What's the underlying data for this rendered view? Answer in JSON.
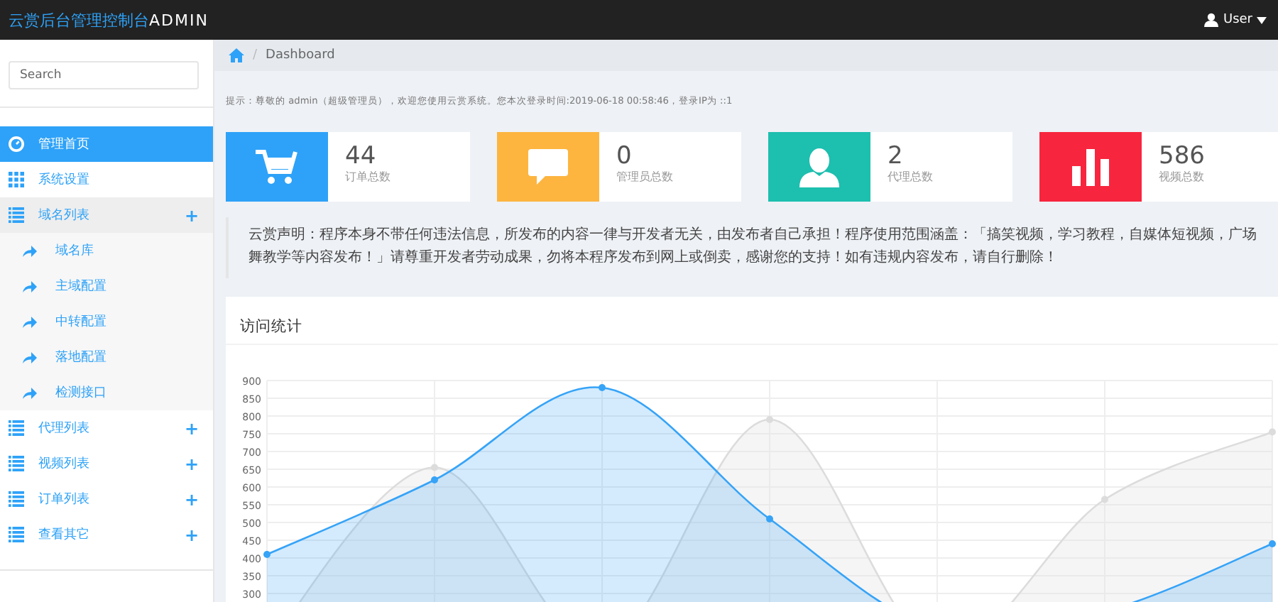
{
  "topbar": {
    "title": "云赏后台管理控制台",
    "title_suffix": "ADMIN",
    "user": "User"
  },
  "sidebar": {
    "search": {
      "placeholder": "Search"
    },
    "items": [
      {
        "label": "管理首页",
        "kind": "link",
        "selected": true
      },
      {
        "label": "系统设置",
        "kind": "link",
        "selected": false
      },
      {
        "label": "域名列表",
        "kind": "group",
        "selected": false,
        "expanded": true,
        "toggle": "+",
        "children": [
          {
            "label": "域名库",
            "selected": false
          },
          {
            "label": "主域配置",
            "selected": false
          },
          {
            "label": "中转配置",
            "selected": false
          },
          {
            "label": "落地配置",
            "selected": false
          },
          {
            "label": "检测接口",
            "selected": false
          }
        ]
      },
      {
        "label": "代理列表",
        "kind": "group",
        "selected": false,
        "expanded": false,
        "toggle": "+"
      },
      {
        "label": "视频列表",
        "kind": "group",
        "selected": false,
        "expanded": false,
        "toggle": "+"
      },
      {
        "label": "订单列表",
        "kind": "group",
        "selected": false,
        "expanded": false,
        "toggle": "+"
      },
      {
        "label": "查看其它",
        "kind": "group",
        "selected": false,
        "expanded": false,
        "toggle": "+"
      }
    ]
  },
  "breadcrumb": {
    "separator": "/",
    "current": "Dashboard"
  },
  "notice": "提示：尊敬的 admin（超级管理员），欢迎您使用云赏系统。您本次登录时间:2019-06-18 00:58:46，登录IP为 ::1",
  "stats": [
    {
      "value": "44",
      "label": "订单总数",
      "color": "#2ea2f8"
    },
    {
      "value": "0",
      "label": "管理员总数",
      "color": "#fdb540"
    },
    {
      "value": "2",
      "label": "代理总数",
      "color": "#1dbfaf"
    },
    {
      "value": "586",
      "label": "视频总数",
      "color": "#f8253e"
    }
  ],
  "announcement": "云赏声明：程序本身不带任何违法信息，所发布的内容一律与开发者无关，由发布者自己承担！程序使用范围涵盖：「搞笑视频，学习教程，自媒体短视频，广场舞教学等内容发布！」请尊重开发者劳动成果，勿将本程序发布到网上或倒卖，感谢您的支持！如有违规内容发布，请自行删除！",
  "visits": {
    "title": "访问统计",
    "chart_data": {
      "type": "area",
      "grid": true,
      "ylim": [
        100,
        900
      ],
      "yticks": [
        300,
        350,
        400,
        450,
        500,
        550,
        600,
        650,
        700,
        750,
        800,
        850,
        900
      ],
      "series": [
        {
          "color": "#dcdcdc",
          "values": [
            150,
            655,
            150,
            790,
            150,
            565,
            755
          ]
        },
        {
          "color": "#36a3f7",
          "values": [
            410,
            620,
            880,
            510,
            200,
            250,
            440
          ]
        }
      ]
    }
  }
}
